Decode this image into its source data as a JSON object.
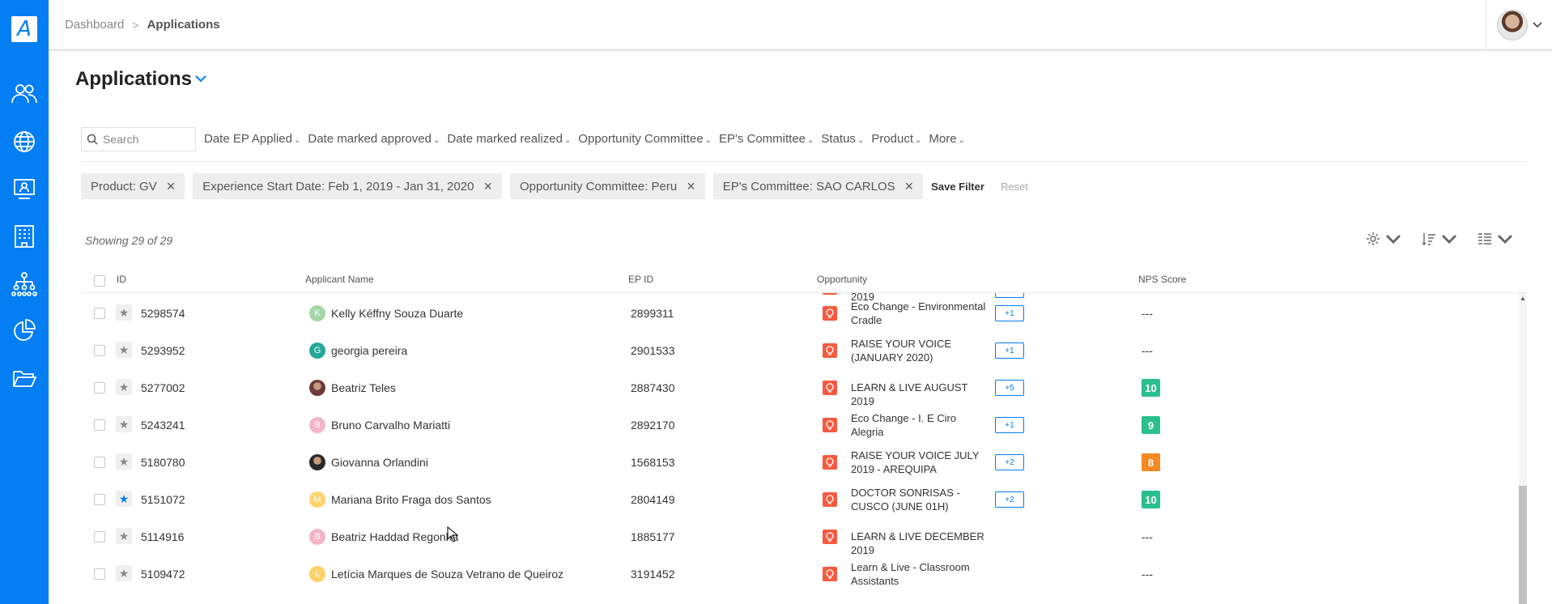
{
  "sidebar": {
    "logo_letter": "A",
    "items": [
      {
        "icon": "people-icon"
      },
      {
        "icon": "globe-icon"
      },
      {
        "icon": "presentation-icon"
      },
      {
        "icon": "building-icon"
      },
      {
        "icon": "org-chart-icon"
      },
      {
        "icon": "pie-chart-icon"
      },
      {
        "icon": "folder-open-icon"
      }
    ],
    "color": "#037ef3"
  },
  "header": {
    "breadcrumb": {
      "parent": "Dashboard",
      "separator": ">",
      "current": "Applications"
    }
  },
  "page": {
    "title": "Applications"
  },
  "search": {
    "placeholder": "Search"
  },
  "filters": [
    "Date EP Applied",
    "Date marked approved",
    "Date marked realized",
    "Opportunity Committee",
    "EP's Committee",
    "Status",
    "Product",
    "More"
  ],
  "active_filters": [
    "Product: GV",
    "Experience Start Date: Feb 1, 2019 - Jan 31, 2020",
    "Opportunity Committee: Peru",
    "EP's Committee: SAO CARLOS"
  ],
  "filter_actions": {
    "save": "Save Filter",
    "reset": "Reset"
  },
  "showing": "Showing 29 of 29",
  "table": {
    "headers": {
      "id": "ID",
      "name": "Applicant Name",
      "epid": "EP ID",
      "opportunity": "Opportunity",
      "nps": "NPS Score"
    },
    "partial_row": {
      "opp_line": "2019"
    },
    "rows": [
      {
        "id": "5298574",
        "initial": "K",
        "avatar_color": "#a5d6a7",
        "name": "Kelly Kéffny Souza Duarte",
        "epid": "2899311",
        "opportunity": "Eco Change - Environmental Cradle",
        "plus": "+1",
        "nps": "---",
        "starred": false
      },
      {
        "id": "5293952",
        "initial": "G",
        "avatar_color": "#26a69a",
        "name": "georgia pereira",
        "epid": "2901533",
        "opportunity": "RAISE YOUR VOICE (JANUARY 2020)",
        "plus": "+1",
        "nps": "---",
        "starred": false
      },
      {
        "id": "5277002",
        "initial": "",
        "avatar_color": "#6d3b3b",
        "name": "Beatriz Teles",
        "epid": "2887430",
        "opportunity": "LEARN & LIVE AUGUST 2019",
        "plus": "+5",
        "nps": "10",
        "nps_color": "#2bbf8f",
        "starred": false
      },
      {
        "id": "5243241",
        "initial": "B",
        "avatar_color": "#f4b6c6",
        "name": "Bruno Carvalho Mariatti",
        "epid": "2892170",
        "opportunity": "Eco Change - I. E Ciro Alegria",
        "plus": "+1",
        "nps": "9",
        "nps_color": "#2bbf8f",
        "starred": false
      },
      {
        "id": "5180780",
        "initial": "",
        "avatar_color": "#2a2a2a",
        "name": "Giovanna Orlandini",
        "epid": "1568153",
        "opportunity": "RAISE YOUR VOICE JULY 2019 - AREQUIPA",
        "plus": "+2",
        "nps": "8",
        "nps_color": "#f48924",
        "starred": false
      },
      {
        "id": "5151072",
        "initial": "M",
        "avatar_color": "#ffd36b",
        "name": "Mariana Brito Fraga dos Santos",
        "epid": "2804149",
        "opportunity": "DOCTOR SONRISAS - CUSCO (JUNE 01H)",
        "plus": "+2",
        "nps": "10",
        "nps_color": "#2bbf8f",
        "starred": true
      },
      {
        "id": "5114916",
        "initial": "B",
        "avatar_color": "#f4b6c6",
        "name": "Beatriz Haddad Regonha",
        "epid": "1885177",
        "opportunity": "LEARN & LIVE DECEMBER 2019",
        "plus": "",
        "nps": "---",
        "starred": false
      },
      {
        "id": "5109472",
        "initial": "L",
        "avatar_color": "#ffd36b",
        "name": "Letícia Marques de Souza Vetrano de Queiroz",
        "epid": "3191452",
        "opportunity": "Learn & Live - Classroom Assistants",
        "plus": "",
        "nps": "---",
        "starred": false
      }
    ]
  }
}
